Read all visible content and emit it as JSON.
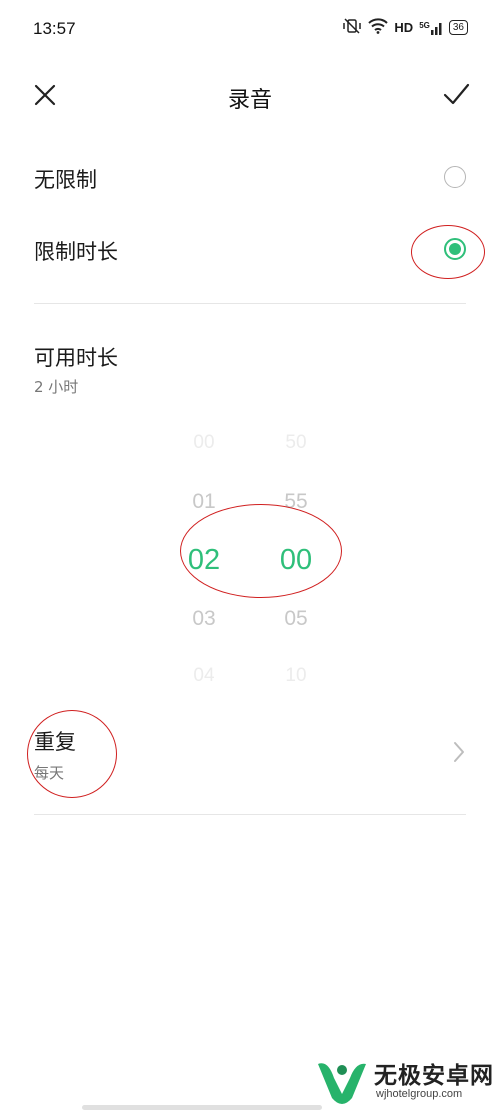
{
  "status_bar": {
    "time": "13:57",
    "network": "HD",
    "signal": "5G",
    "battery": "36",
    "icons": [
      "vibrate-off-icon",
      "wifi-icon",
      "signal-icon",
      "battery-icon"
    ]
  },
  "header": {
    "title": "录音",
    "close_icon": "close-icon",
    "confirm_icon": "check-icon"
  },
  "options": [
    {
      "label": "无限制",
      "selected": false
    },
    {
      "label": "限制时长",
      "selected": true
    }
  ],
  "available_duration": {
    "title": "可用时长",
    "value": "2 小时"
  },
  "time_picker": {
    "hours": [
      "00",
      "01",
      "02",
      "03",
      "04"
    ],
    "minutes": [
      "50",
      "55",
      "00",
      "05",
      "10"
    ],
    "selected_hour": "02",
    "selected_minute": "00"
  },
  "repeat": {
    "label": "重复",
    "value": "每天",
    "chevron_icon": "chevron-right-icon"
  },
  "watermark": {
    "text": "无极安卓网",
    "url": "wjhotelgroup.com"
  },
  "colors": {
    "accent": "#2fbf7a",
    "annotation": "#d02020",
    "muted_text": "#777777",
    "faded_picker_text": "#c8c8c8"
  }
}
